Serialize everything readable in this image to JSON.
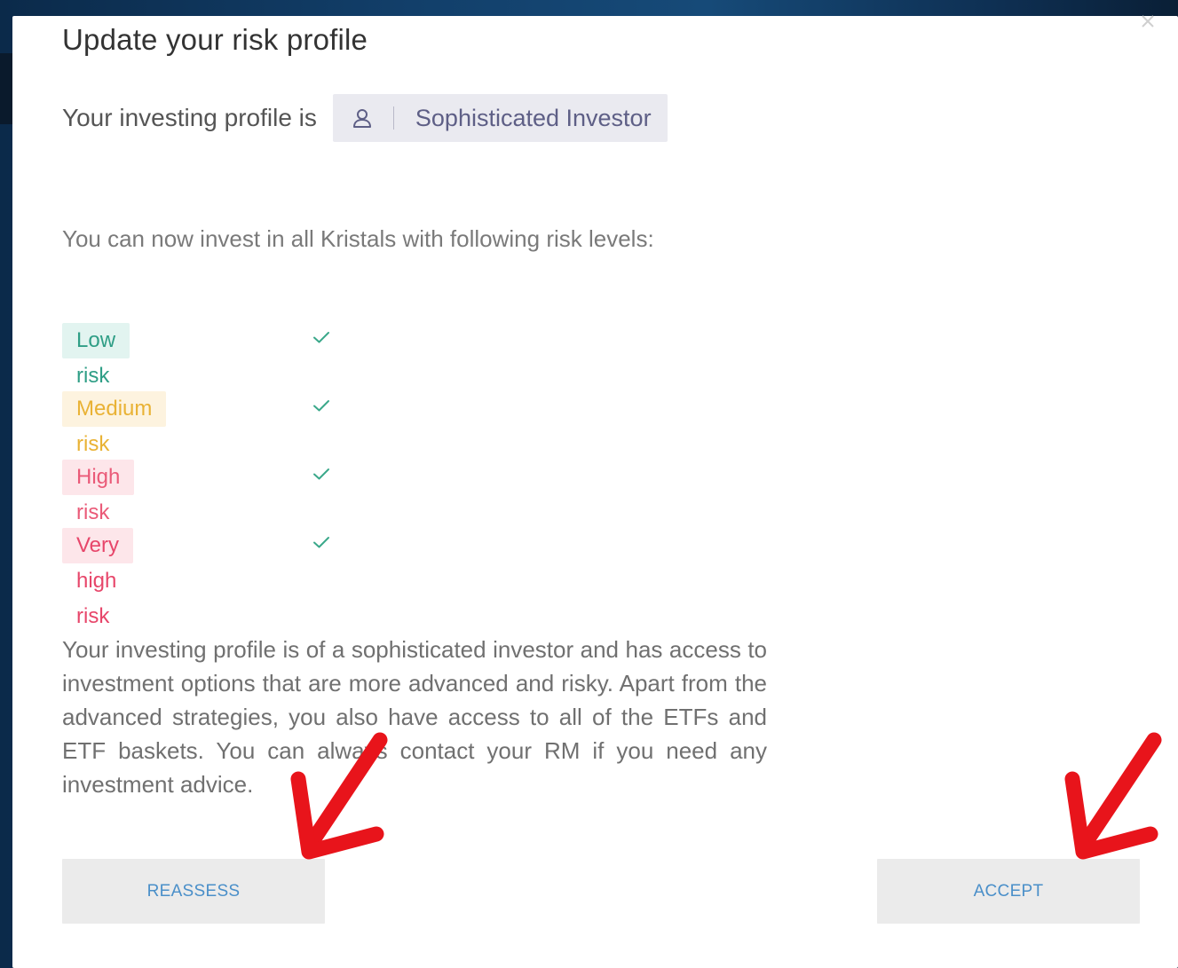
{
  "dialog": {
    "title": "Update your risk profile",
    "close_icon": "close-icon",
    "profile": {
      "prefix": "Your investing profile is",
      "icon": "user-icon",
      "value": "Sophisticated Investor"
    },
    "intro": "You can now invest in all Kristals with following risk levels:",
    "risk_levels": [
      {
        "label": "Low risk",
        "color": "#2f9e86",
        "allowed": true
      },
      {
        "label": "Medium risk",
        "color": "#e9b234",
        "allowed": true
      },
      {
        "label": "High risk",
        "color": "#ea5a78",
        "allowed": true
      },
      {
        "label": "Very high risk",
        "color": "#e7466a",
        "allowed": true
      }
    ],
    "description": "Your investing profile is of a sophisticated investor and has access to investment options that are more advanced and risky. Apart from the advanced strategies, you also have access to all of the ETFs and ETF baskets. You can always contact your RM if you need any investment advice.",
    "buttons": {
      "reassess": "REASSESS",
      "accept": "ACCEPT"
    }
  },
  "colors": {
    "accent": "#4a8fc9",
    "check": "#3aa88a",
    "annotation_arrow": "#e8141b"
  }
}
